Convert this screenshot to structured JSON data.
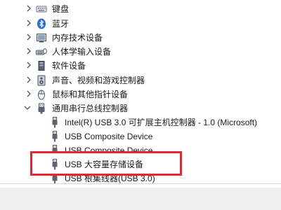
{
  "tree": {
    "categories": [
      {
        "label": "键盘",
        "icon": "keyboard-icon",
        "expanded": false
      },
      {
        "label": "蓝牙",
        "icon": "bluetooth-icon",
        "expanded": false
      },
      {
        "label": "内存技术设备",
        "icon": "memory-device-icon",
        "expanded": false
      },
      {
        "label": "人体学输入设备",
        "icon": "hid-icon",
        "expanded": false
      },
      {
        "label": "软件设备",
        "icon": "software-device-icon",
        "expanded": false
      },
      {
        "label": "声音、视频和游戏控制器",
        "icon": "speaker-icon",
        "expanded": false
      },
      {
        "label": "鼠标和其他指针设备",
        "icon": "mouse-icon",
        "expanded": false
      },
      {
        "label": "通用串行总线控制器",
        "icon": "usb-controller-icon",
        "expanded": true
      }
    ],
    "usb_children": [
      {
        "label": "Intel(R) USB 3.0 可扩展主机控制器 - 1.0 (Microsoft)",
        "icon": "usb-plug-icon"
      },
      {
        "label": "USB Composite Device",
        "icon": "usb-plug-icon"
      },
      {
        "label": "USB Composite Device",
        "icon": "usb-plug-icon"
      },
      {
        "label": "USB 大容量存储设备",
        "icon": "usb-plug-icon",
        "highlighted": true
      },
      {
        "label": "USB 根集线器(USB 3.0)",
        "icon": "usb-plug-icon"
      }
    ]
  },
  "colors": {
    "highlight_border": "#e8262e",
    "bluetooth_blue": "#1f6fd1",
    "chevron": "#555555"
  }
}
